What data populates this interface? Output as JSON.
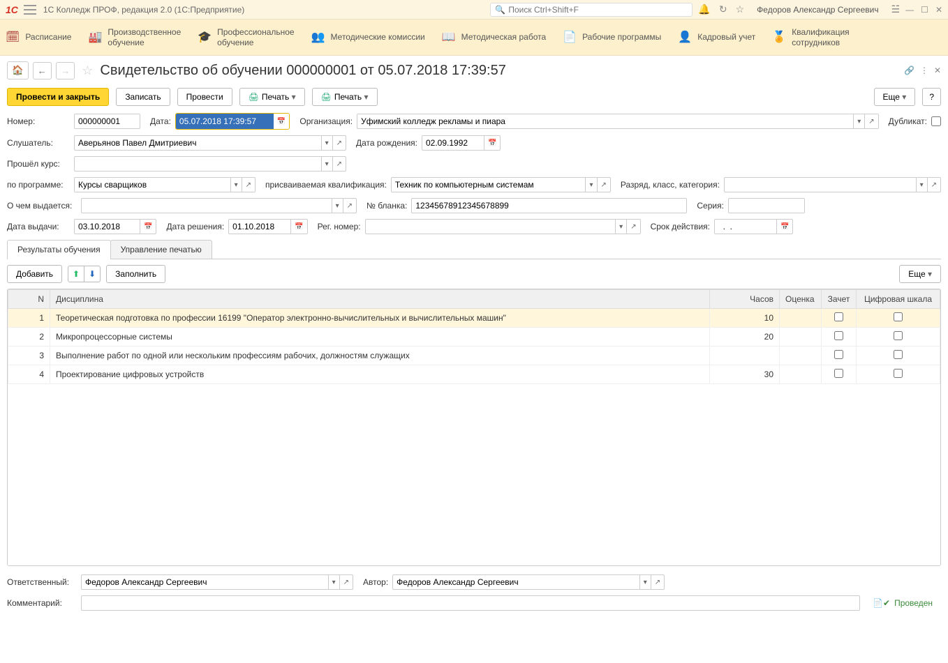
{
  "sysbar": {
    "title": "1С Колледж ПРОФ, редакция 2.0  (1С:Предприятие)",
    "search_placeholder": "Поиск Ctrl+Shift+F",
    "username": "Федоров Александр Сергеевич"
  },
  "nav": {
    "items": [
      "Расписание",
      "Производственное\nобучение",
      "Профессиональное\nобучение",
      "Методические комиссии",
      "Методическая работа",
      "Рабочие программы",
      "Кадровый учет",
      "Квалификация\nсотрудников"
    ]
  },
  "page": {
    "title": "Свидетельство об обучении 000000001 от 05.07.2018 17:39:57"
  },
  "cmd": {
    "post_close": "Провести и закрыть",
    "save": "Записать",
    "post": "Провести",
    "print1": "Печать",
    "print2": "Печать",
    "more": "Еще",
    "help": "?"
  },
  "form": {
    "number_label": "Номер:",
    "number": "000000001",
    "date_label": "Дата:",
    "date": "05.07.2018 17:39:57",
    "org_label": "Организация:",
    "org": "Уфимский колледж рекламы и пиара",
    "duplicate_label": "Дубликат:",
    "student_label": "Слушатель:",
    "student": "Аверьянов Павел Дмитриевич",
    "birth_label": "Дата рождения:",
    "birth": "02.09.1992",
    "course_label": "Прошёл курс:",
    "program_label": "по программе:",
    "program": "Курсы сварщиков",
    "qual_label": "присваиваемая квалификация:",
    "qual": "Техник по компьютерным системам",
    "rank_label": "Разряд, класс, категория:",
    "about_label": "О чем выдается:",
    "blank_label": "№ бланка:",
    "blank": "12345678912345678899",
    "series_label": "Серия:",
    "issue_date_label": "Дата выдачи:",
    "issue_date": "03.10.2018",
    "decision_date_label": "Дата решения:",
    "decision_date": "01.10.2018",
    "reg_label": "Рег. номер:",
    "validity_label": "Срок действия:",
    "validity": "  .  .    "
  },
  "tabs": {
    "results": "Результаты обучения",
    "print_mgmt": "Управление печатью"
  },
  "ttbar": {
    "add": "Добавить",
    "fill": "Заполнить",
    "more": "Еще"
  },
  "table": {
    "cols": {
      "n": "N",
      "discipline": "Дисциплина",
      "hours": "Часов",
      "grade": "Оценка",
      "credit": "Зачет",
      "scale": "Цифровая шкала"
    },
    "rows": [
      {
        "n": "1",
        "discipline": "Теоретическая подготовка по профессии 16199 \"Оператор электронно-вычислительных и вычислительных машин\"",
        "hours": "10"
      },
      {
        "n": "2",
        "discipline": "Микропроцессорные системы",
        "hours": "20"
      },
      {
        "n": "3",
        "discipline": "Выполнение работ по одной или нескольким профессиям рабочих, должностям служащих",
        "hours": ""
      },
      {
        "n": "4",
        "discipline": "Проектирование цифровых устройств",
        "hours": "30"
      }
    ]
  },
  "footer": {
    "responsible_label": "Ответственный:",
    "responsible": "Федоров Александр Сергеевич",
    "author_label": "Автор:",
    "author": "Федоров Александр Сергеевич",
    "comment_label": "Комментарий:",
    "status": "Проведен"
  }
}
